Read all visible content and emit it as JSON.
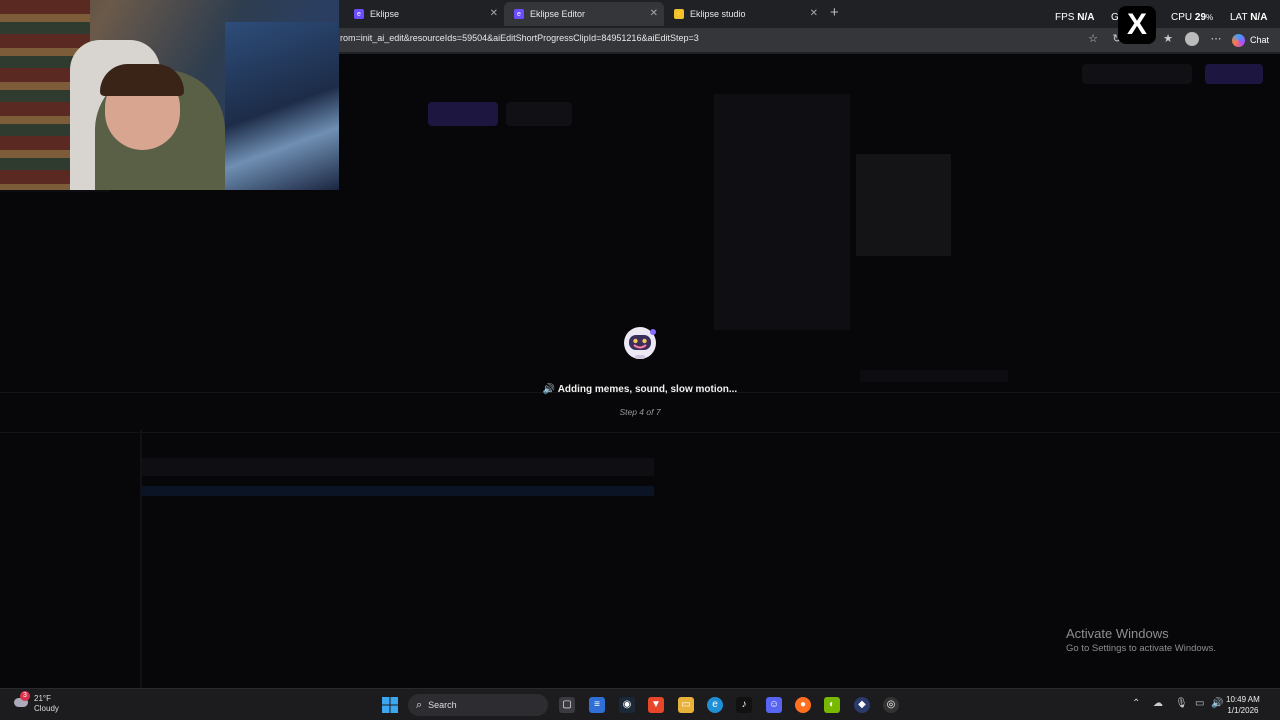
{
  "browser": {
    "tabs": [
      {
        "title": "Eklipse",
        "active": false
      },
      {
        "title": "Eklipse Editor",
        "active": true
      },
      {
        "title": "Eklipse studio",
        "active": false
      }
    ],
    "new_tab": "+",
    "url": "rom=init_ai_edit&resourceIds=59504&aiEditShortProgressClipId=84951216&aiEditStep=3",
    "chat_label": "Chat"
  },
  "overlay_stats": {
    "fps_label": "FPS",
    "fps_value": "N/A",
    "gpu_label": "G",
    "cpu_label": "CPU",
    "cpu_value": "29",
    "cpu_unit": "%",
    "lat_label": "LAT",
    "lat_value": "N/A"
  },
  "loading": {
    "icon": "speaker-icon",
    "status": "Adding memes, sound, slow motion...",
    "step": "Step 4 of 7"
  },
  "watermark": {
    "title": "Activate Windows",
    "subtitle": "Go to Settings to activate Windows."
  },
  "taskbar": {
    "weather_badge": "3",
    "temperature": "21°F",
    "condition": "Cloudy",
    "search_placeholder": "Search",
    "time": "10:49 AM",
    "date": "1/1/2026"
  },
  "colors": {
    "accent": "#6b4cff",
    "browser_bg": "#202124",
    "page_bg": "#070709",
    "taskbar_bg": "#1c1c1f"
  }
}
